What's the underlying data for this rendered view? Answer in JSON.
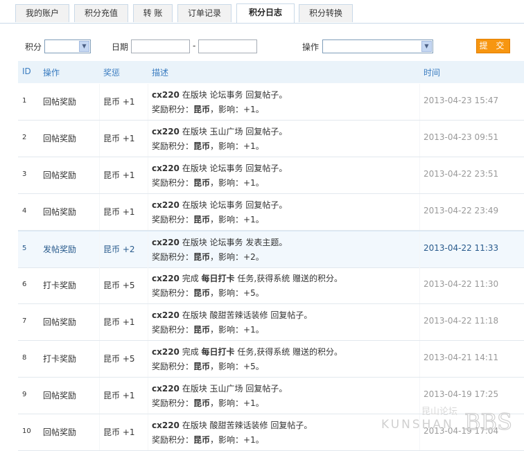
{
  "tabs": [
    "我的账户",
    "积分充值",
    "转 账",
    "订单记录",
    "积分日志",
    "积分转换"
  ],
  "filter": {
    "credit_label": "积分",
    "date_label": "日期",
    "date_sep": "-",
    "action_label": "操作",
    "submit_label": "提 交"
  },
  "table": {
    "headers": [
      "ID",
      "操作",
      "奖惩",
      "描述",
      "时间"
    ],
    "rows": [
      {
        "id": "1",
        "op": "回帖奖励",
        "reward": "昆币 +1",
        "user": "cx220",
        "desc_a": " 在版块 论坛事务 回复帖子。",
        "credit_name": "昆币",
        "effect": "+1",
        "time": "2013-04-23 15:47"
      },
      {
        "id": "2",
        "op": "回帖奖励",
        "reward": "昆币 +1",
        "user": "cx220",
        "desc_a": " 在版块 玉山广场 回复帖子。",
        "credit_name": "昆币",
        "effect": "+1",
        "time": "2013-04-23 09:51"
      },
      {
        "id": "3",
        "op": "回帖奖励",
        "reward": "昆币 +1",
        "user": "cx220",
        "desc_a": " 在版块 论坛事务 回复帖子。",
        "credit_name": "昆币",
        "effect": "+1",
        "time": "2013-04-22 23:51"
      },
      {
        "id": "4",
        "op": "回帖奖励",
        "reward": "昆币 +1",
        "user": "cx220",
        "desc_a": " 在版块 论坛事务 回复帖子。",
        "credit_name": "昆币",
        "effect": "+1",
        "time": "2013-04-22 23:49"
      },
      {
        "id": "5",
        "op": "发帖奖励",
        "reward": "昆币 +2",
        "user": "cx220",
        "desc_a": " 在版块 论坛事务 发表主题。",
        "credit_name": "昆币",
        "effect": "+2",
        "time": "2013-04-22 11:33"
      },
      {
        "id": "6",
        "op": "打卡奖励",
        "reward": "昆币 +5",
        "user": "cx220",
        "desc_a": " 完成 ",
        "task": "每日打卡",
        "desc_b": " 任务,获得系统 赠送的积分。",
        "credit_name": "昆币",
        "effect": "+5",
        "time": "2013-04-22 11:30"
      },
      {
        "id": "7",
        "op": "回帖奖励",
        "reward": "昆币 +1",
        "user": "cx220",
        "desc_a": " 在版块 酸甜苦辣话装修 回复帖子。",
        "credit_name": "昆币",
        "effect": "+1",
        "time": "2013-04-22 11:18"
      },
      {
        "id": "8",
        "op": "打卡奖励",
        "reward": "昆币 +5",
        "user": "cx220",
        "desc_a": " 完成 ",
        "task": "每日打卡",
        "desc_b": " 任务,获得系统 赠送的积分。",
        "credit_name": "昆币",
        "effect": "+5",
        "time": "2013-04-21 14:11"
      },
      {
        "id": "9",
        "op": "回帖奖励",
        "reward": "昆币 +1",
        "user": "cx220",
        "desc_a": " 在版块 玉山广场 回复帖子。",
        "credit_name": "昆币",
        "effect": "+1",
        "time": "2013-04-19 17:25"
      },
      {
        "id": "10",
        "op": "回帖奖励",
        "reward": "昆币 +1",
        "user": "cx220",
        "desc_a": " 在版块 酸甜苦辣话装修 回复帖子。",
        "credit_name": "昆币",
        "effect": "+1",
        "time": "2013-04-19 17:04"
      }
    ],
    "line2_prefix": "奖励积分：",
    "line2_mid": "，影响：",
    "line2_end": "。"
  },
  "watermark": {
    "cn": "昆山论坛",
    "en": "KUNSHAN",
    "bbs": "BBS"
  }
}
